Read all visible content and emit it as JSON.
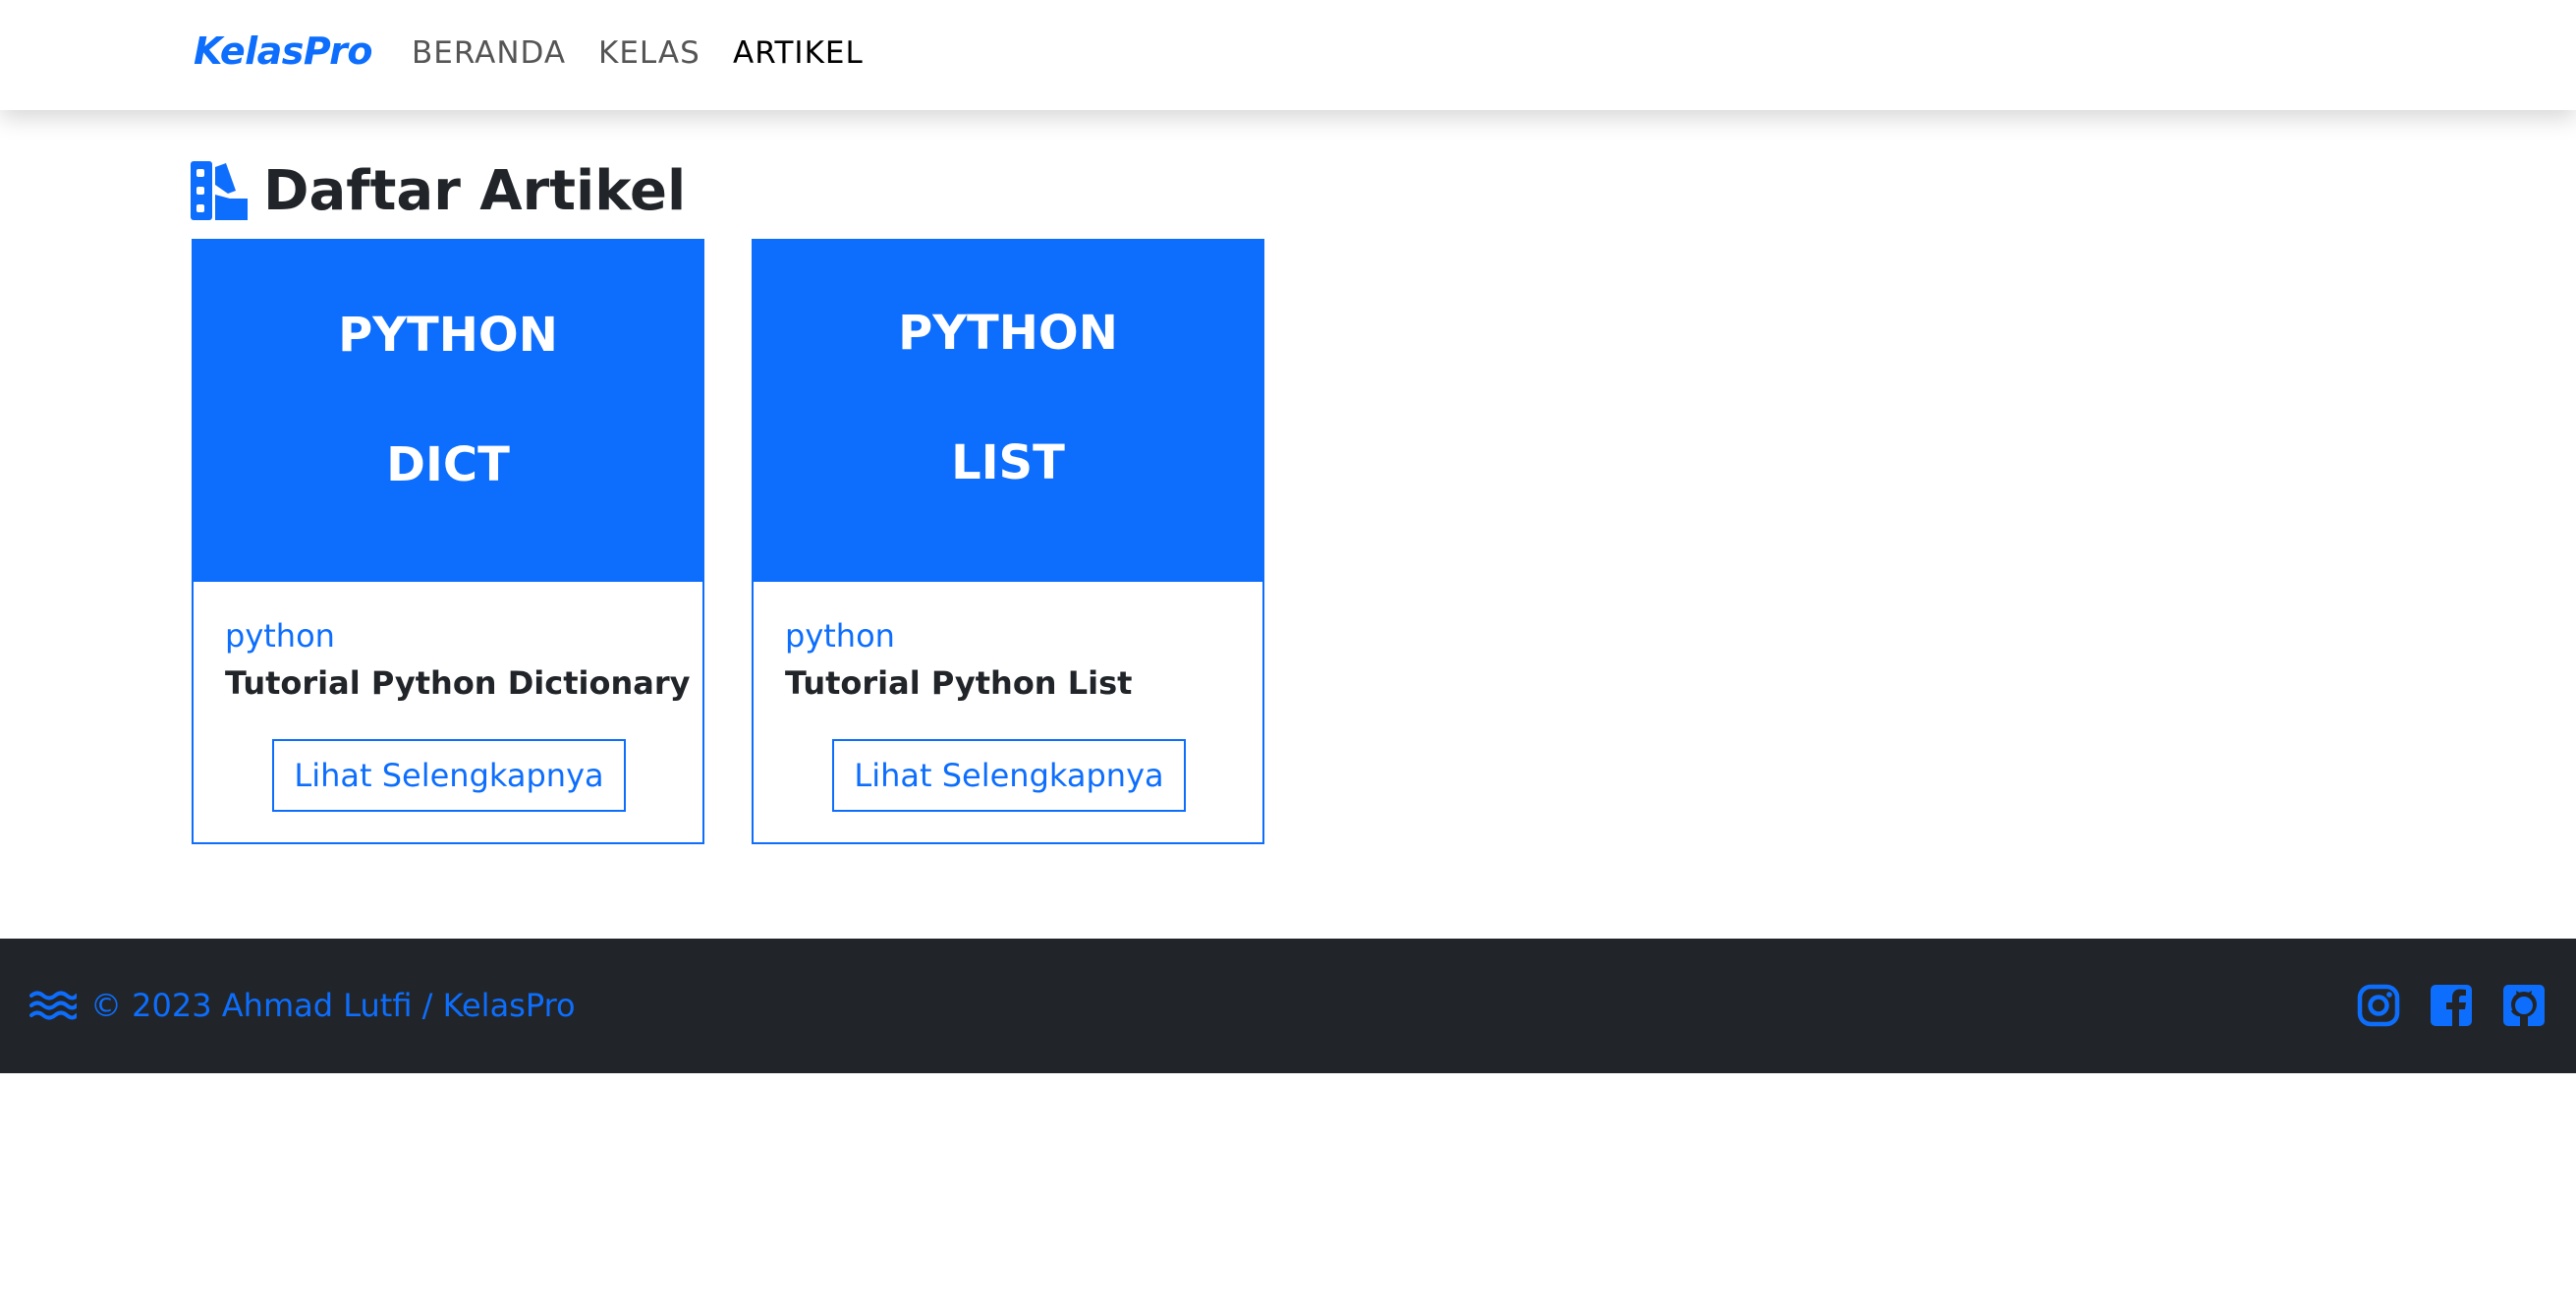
{
  "navbar": {
    "brand": "KelasPro",
    "links": [
      {
        "label": "BERANDA",
        "active": false
      },
      {
        "label": "KELAS",
        "active": false
      },
      {
        "label": "ARTIKEL",
        "active": true
      }
    ]
  },
  "page": {
    "title": "Daftar Artikel",
    "icon": "swatchbook-icon"
  },
  "articles": [
    {
      "cover_lines": [
        "PYTHON",
        "DICT"
      ],
      "tag": "python",
      "title": "Tutorial Python Dictionary",
      "button": "Lihat Selengkapnya"
    },
    {
      "cover_lines": [
        "PYTHON",
        "LIST"
      ],
      "tag": "python",
      "title": "Tutorial Python List",
      "button": "Lihat Selengkapnya"
    }
  ],
  "footer": {
    "icon": "water-waves-icon",
    "copyright": "© 2023 Ahmad Lutfi / KelasPro",
    "social": [
      "instagram-icon",
      "facebook-icon",
      "github-icon"
    ]
  },
  "colors": {
    "primary": "#0d6efd",
    "dark": "#212529",
    "nav_text": "#555555"
  }
}
